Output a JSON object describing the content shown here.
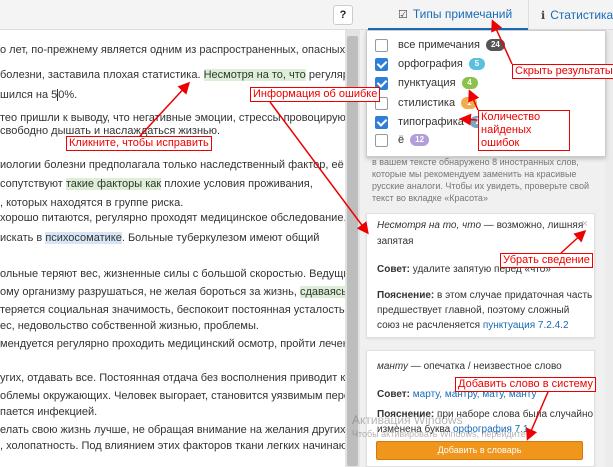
{
  "toolbar": {
    "help_label": "?",
    "tab_notes": "Типы примечаний",
    "tab_stats": "Статистика"
  },
  "editor": {
    "lines": [
      "о лет, по-прежнему является одним из распространенных, опасных",
      "болезни, заставила плохая статистика.",
      "Несмотря на то, что",
      " регулярно",
      "шился на 5",
      "0%.",
      "тео пришли к выводу, что негативные эмоции, стрессы провоцируют",
      "свободно дышать и наслаждаться жизнью.",
      "иологии болезни предполагала только наследственный фактор, её",
      "сопутствуют",
      "такие факторы как",
      " плохие условия проживания,",
      ", которых находятся в группе риска.",
      "хорошо питаются, регулярно проходят медицинское обследование.",
      " искать в",
      "психосоматике",
      ". Больные туберкулезом имеют общий",
      "ольные теряют вес, жизненные силы с большой скоростью. Ведущие",
      "ому организму разрушаться, не желая бороться за жизнь,",
      "сдаваясь",
      "теряется социальная значимость, беспокоит постоянная усталость.",
      "ес, недовольство собственной жизнью, проблемы.",
      "мендуется регулярно проходить медицинский осмотр, пройти лечение",
      "угих, отдавать все. Постоянная отдача без восполнения приводит к",
      "облемы окружающих. Человек выгорает, становится уязвимым перед",
      "пается инфекцией.",
      "елать свою жизнь лучше, не обращая внимание на желания других.",
      ", холопатность. Под влиянием этих факторов ткани легких начинают"
    ]
  },
  "filters": [
    {
      "label": "все примечания",
      "count": "24",
      "checked": false,
      "color": "#555555"
    },
    {
      "label": "орфография",
      "count": "5",
      "checked": true,
      "color": "#5bc0de"
    },
    {
      "label": "пунктуация",
      "count": "4",
      "checked": true,
      "color": "#8bc34a"
    },
    {
      "label": "стилистика",
      "count": "1",
      "checked": false,
      "color": "#f0ad4e"
    },
    {
      "label": "типографика",
      "count": "2",
      "checked": true,
      "color": "#7aa7c7"
    },
    {
      "label": "ё",
      "count": "12",
      "checked": false,
      "color": "#b39ddb"
    }
  ],
  "sidebar": {
    "faded_text": [
      "в вашем тексте обнаружено 8 иностранных слов,",
      "которые мы рекомендуем заменить на красивые",
      "русские аналоги. Чтобы их увидеть, проверьте свой",
      "текст во вкладке «Красота»"
    ],
    "card1": {
      "title_italic": "Несмотря на то, что",
      "title_rest": " — возможно, лишняя",
      "title_line2": "запятая",
      "advice_label": "Совет:",
      "advice_text": " удалите запятую перед «что»",
      "expl_label": "Пояснение:",
      "expl_text": " в этом случае придаточная часть",
      "expl_line2": "предшествует главной, поэтому сложный",
      "expl_line3": "союз не расчленяется ",
      "expl_link": "пунктуация 7.2.4.2"
    },
    "card2": {
      "title_italic": "манту",
      "title_rest": " — опечатка / неизвестное слово",
      "advice_label": "Совет:",
      "advice_text": " ",
      "advice_links": "марту, мантру, мату, манту",
      "expl_label": "Пояснение:",
      "expl_text": " при наборе слова была случайно",
      "expl_line2": "изменена буква ",
      "expl_link": "орфография 7.1"
    },
    "add_button": "Добавить в словарь"
  },
  "watermark": {
    "title": "Активация Windows",
    "subtitle": "Чтобы активировать Windows, перейдите в"
  },
  "annotations": {
    "click_fix": "Кликните, чтобы исправить",
    "error_info": "Информация об ошибке",
    "hide_results": "Скрыть результаты",
    "errors_count": "Количество найденых ошибок",
    "remove_info": "Убрать сведение",
    "add_word": "Добавить слово в систему"
  },
  "colors": {
    "accent": "#1a6bb8",
    "annotation": "#ee0000",
    "button": "#f0961c"
  }
}
